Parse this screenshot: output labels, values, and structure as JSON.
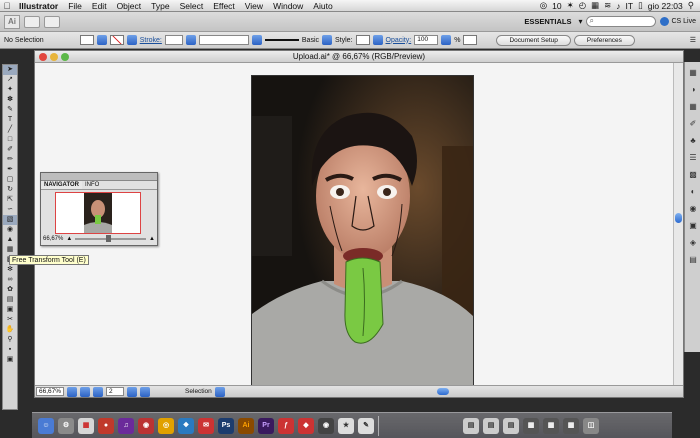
{
  "menubar": {
    "app": "Illustrator",
    "items": [
      "File",
      "Edit",
      "Object",
      "Type",
      "Select",
      "Effect",
      "View",
      "Window",
      "Aiuto"
    ],
    "status": {
      "adobe_count": "10",
      "language": "IT",
      "clock": "gio 22:03"
    }
  },
  "appbar": {
    "app_icon": "Ai",
    "workspace": "ESSENTIALS",
    "search_placeholder": "",
    "cs_live": "CS Live"
  },
  "control": {
    "selection": "No Selection",
    "stroke_label": "Stroke:",
    "brush": "Basic",
    "style_label": "Style:",
    "opacity_label": "Opacity:",
    "opacity_value": "100",
    "opacity_unit": "%",
    "doc_setup": "Document Setup",
    "preferences": "Preferences"
  },
  "tooltip": "Free Transform Tool (E)",
  "document": {
    "title": "Upload.ai* @ 66,67% (RGB/Preview)",
    "zoom": "66,67%",
    "page": "2",
    "status": "Selection"
  },
  "navigator": {
    "tabs": [
      "NAVIGATOR",
      "INFO"
    ],
    "zoom": "66,67%"
  },
  "tools": [
    "selection-tool",
    "direct-selection-tool",
    "magic-wand-tool",
    "lasso-tool",
    "pen-tool",
    "type-tool",
    "line-tool",
    "rectangle-tool",
    "paintbrush-tool",
    "pencil-tool",
    "blob-brush-tool",
    "eraser-tool",
    "rotate-tool",
    "scale-tool",
    "width-tool",
    "free-transform-tool",
    "shape-builder-tool",
    "perspective-tool",
    "mesh-tool",
    "gradient-tool",
    "eyedropper-tool",
    "blend-tool",
    "symbol-sprayer-tool",
    "graph-tool",
    "artboard-tool",
    "slice-tool",
    "hand-tool",
    "zoom-tool"
  ],
  "colors": {
    "tongue": "#7ac943",
    "accent": "#2c63c4"
  }
}
